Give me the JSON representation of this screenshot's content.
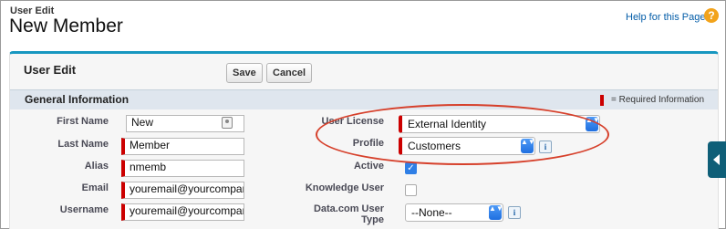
{
  "header": {
    "subtitle": "User Edit",
    "title": "New Member",
    "help_link": "Help for this Page",
    "help_icon": "?"
  },
  "panel": {
    "title": "User Edit",
    "save_label": "Save",
    "cancel_label": "Cancel"
  },
  "section": {
    "title": "General Information",
    "required_note": "= Required Information"
  },
  "fields": {
    "first_name": {
      "label": "First Name",
      "value": "New"
    },
    "last_name": {
      "label": "Last Name",
      "value": "Member"
    },
    "alias": {
      "label": "Alias",
      "value": "nmemb"
    },
    "email": {
      "label": "Email",
      "value": "youremail@yourcompan"
    },
    "username": {
      "label": "Username",
      "value": "youremail@yourcompan"
    },
    "user_license": {
      "label": "User License",
      "value": "External Identity"
    },
    "profile": {
      "label": "Profile",
      "value": "Customers"
    },
    "active": {
      "label": "Active",
      "checked": true
    },
    "knowledge_user": {
      "label": "Knowledge User",
      "checked": false
    },
    "datacom_user_type": {
      "label": "Data.com User Type",
      "value": "--None--"
    }
  },
  "icons": {
    "info": "i",
    "checkmark": "✓",
    "select_arrows": "▲▼"
  },
  "colors": {
    "accent": "#1797c0",
    "required": "#cc0000",
    "highlight": "#d6402b",
    "link": "#015ba7"
  }
}
